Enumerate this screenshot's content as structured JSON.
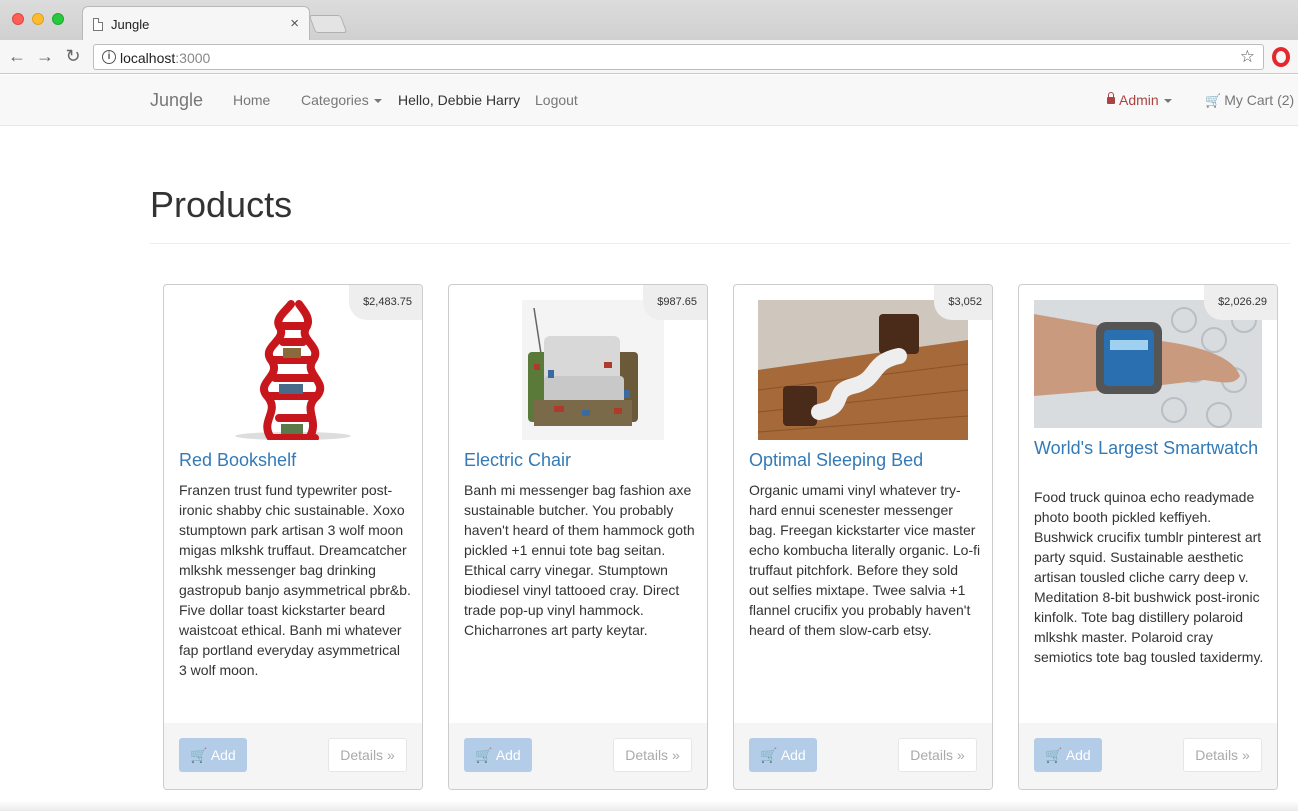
{
  "browser": {
    "tab_title": "Jungle",
    "tab_close": "×",
    "url_host": "localhost",
    "url_port": ":3000"
  },
  "navbar": {
    "brand": "Jungle",
    "home": "Home",
    "categories": "Categories",
    "greeting": "Hello, Debbie Harry",
    "logout": "Logout",
    "admin": "Admin",
    "cart": "My Cart (2)"
  },
  "page": {
    "title": "Products"
  },
  "products": [
    {
      "name": "Red Bookshelf",
      "price": "$2,483.75",
      "description": "Franzen trust fund typewriter post-ironic shabby chic sustainable. Xoxo stumptown park artisan 3 wolf moon migas mlkshk truffaut. Dreamcatcher mlkshk messenger bag drinking gastropub banjo asymmetrical pbr&b. Five dollar toast kickstarter beard waistcoat ethical. Banh mi whatever fap portland everyday asymmetrical 3 wolf moon.",
      "add_label": "Add",
      "details_label": "Details »"
    },
    {
      "name": "Electric Chair",
      "price": "$987.65",
      "description": "Banh mi messenger bag fashion axe sustainable butcher. You probably haven't heard of them hammock goth pickled +1 ennui tote bag seitan. Ethical carry vinegar. Stumptown biodiesel vinyl tattooed cray. Direct trade pop-up vinyl hammock. Chicharrones art party keytar.",
      "add_label": "Add",
      "details_label": "Details »"
    },
    {
      "name": "Optimal Sleeping Bed",
      "price": "$3,052",
      "description": "Organic umami vinyl whatever try-hard ennui scenester messenger bag. Freegan kickstarter vice master echo kombucha literally organic. Lo-fi truffaut pitchfork. Before they sold out selfies mixtape. Twee salvia +1 flannel crucifix you probably haven't heard of them slow-carb etsy.",
      "add_label": "Add",
      "details_label": "Details »"
    },
    {
      "name": "World's Largest Smartwatch",
      "price": "$2,026.29",
      "description": "Food truck quinoa echo readymade photo booth pickled keffiyeh. Bushwick crucifix tumblr pinterest art party squid. Sustainable aesthetic artisan tousled cliche carry deep v. Meditation 8-bit bushwick post-ironic kinfolk. Tote bag distillery polaroid mlkshk master. Polaroid cray semiotics tote bag tousled taxidermy.",
      "add_label": "Add",
      "details_label": "Details »"
    }
  ],
  "colors": {
    "link": "#337ab7",
    "admin": "#a94442",
    "add_button": "#b3cde8"
  }
}
